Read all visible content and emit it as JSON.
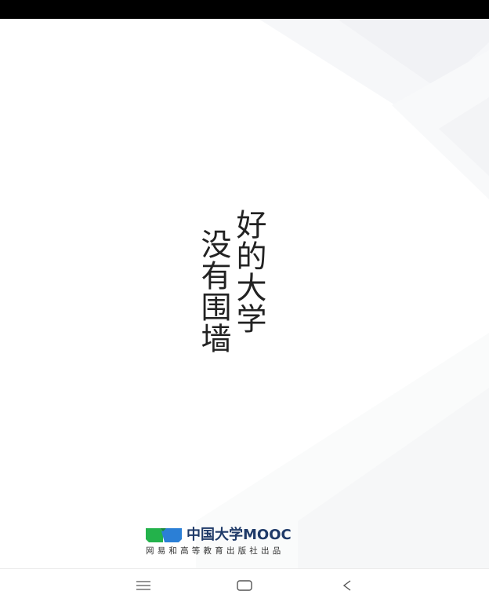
{
  "splash": {
    "tagline_line1": "好的大学",
    "tagline_line2": "没有围墙"
  },
  "brand": {
    "name": "中国大学MOOC",
    "subtitle": "网易和高等教育出版社出品",
    "logo_colors": {
      "green": "#23b24b",
      "blue": "#2b7fd6",
      "navy": "#1f3a68"
    }
  },
  "nav_bar": {
    "menu_icon": "menu-icon",
    "home_icon": "home-icon",
    "back_icon": "back-icon"
  },
  "colors": {
    "status_bar": "#000000",
    "background": "#ffffff",
    "tagline_text": "#222222"
  }
}
